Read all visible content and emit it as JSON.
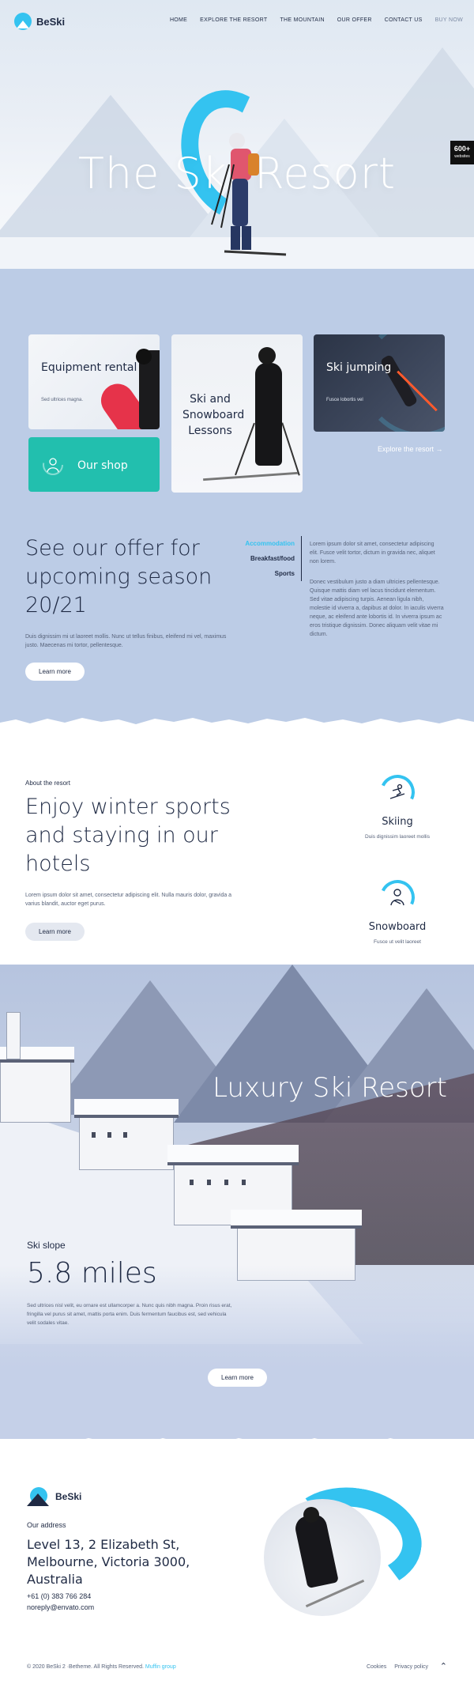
{
  "nav": {
    "logo": "BeSki",
    "items": [
      "HOME",
      "EXPLORE THE RESORT",
      "THE MOUNTAIN",
      "OUR OFFER",
      "CONTACT US"
    ],
    "buy": "BUY NOW"
  },
  "hero": {
    "title": "The Ski  Resort",
    "badge_number": "600+",
    "badge_label": "websites"
  },
  "cards": {
    "equipment": {
      "title": "Equipment rental",
      "sub": "Sed ultrices magna."
    },
    "lessons": {
      "title": "Ski and Snowboard Lessons"
    },
    "jumping": {
      "title": "Ski jumping",
      "sub": "Fusce lobortis vel"
    },
    "shop": {
      "title": "Our shop"
    },
    "explore": "Explore the resort →"
  },
  "offer": {
    "title": "See our offer for upcoming season 20/21",
    "text": "Duis dignissim mi ut laoreet mollis. Nunc ut tellus finibus, eleifend mi vel, maximus justo. Maecenas mi tortor, pellentesque.",
    "button": "Learn more",
    "tabs": [
      "Accommodation",
      "Breakfast/food",
      "Sports"
    ],
    "active_tab": 0,
    "p1": "Lorem ipsum dolor sit amet, consectetur adipiscing elit. Fusce velit tortor, dictum in gravida nec, aliquet non lorem.",
    "p2": "Donec vestibulum justo a diam ultricies pellentesque. Quisque mattis diam vel lacus tincidunt elementum. Sed vitae adipiscing turpis. Aenean ligula nibh, molestie id viverra a, dapibus at dolor. In iaculis viverra neque, ac eleifend ante lobortis id. In viverra ipsum ac eros tristique dignissim. Donec aliquam velit vitae mi dictum."
  },
  "about": {
    "eyebrow": "About the resort",
    "title": "Enjoy winter sports and staying in our hotels",
    "text": "Lorem ipsum dolor sit amet, consectetur adipiscing elit. Nulla mauris dolor, gravida a varius blandit, auctor eget purus.",
    "button": "Learn more",
    "features": [
      {
        "name": "Skiing",
        "sub": "Duis dignissim laoreet mollis",
        "icon": "skier-icon"
      },
      {
        "name": "Snowboard",
        "sub": "Fusce ut velit laoreet",
        "icon": "snowboarder-icon"
      }
    ]
  },
  "luxury": {
    "title": "Luxury Ski Resort",
    "slope_label": "Ski slope",
    "slope_value": "5.8 miles",
    "text": "Sed ultrices nisl velit, eu ornare est ullamcorper a. Nunc quis nibh magna. Proin risus erat, fringilla vel purus sit amet, mattis porta enim. Duis fermentum faucibus est, sed vehicula velit sodales vitae.",
    "button": "Learn more"
  },
  "footer": {
    "logo": "BeSki",
    "address_label": "Our address",
    "address": "Level 13, 2 Elizabeth St, Melbourne, Victoria 3000, Australia",
    "phone": "+61 (0) 383 766 284",
    "email": "noreply@envato.com",
    "copyright": "© 2020 BeSki 2 ·Betheme. All Rights Reserved.",
    "copyright_group": "Muffin group",
    "links": [
      "Cookies",
      "Privacy policy"
    ],
    "to_top": "⌃"
  },
  "colors": {
    "accent": "#34c3f0",
    "shop": "#22bfae",
    "navy": "#1f2a44",
    "page_bg": "#bccce6"
  }
}
